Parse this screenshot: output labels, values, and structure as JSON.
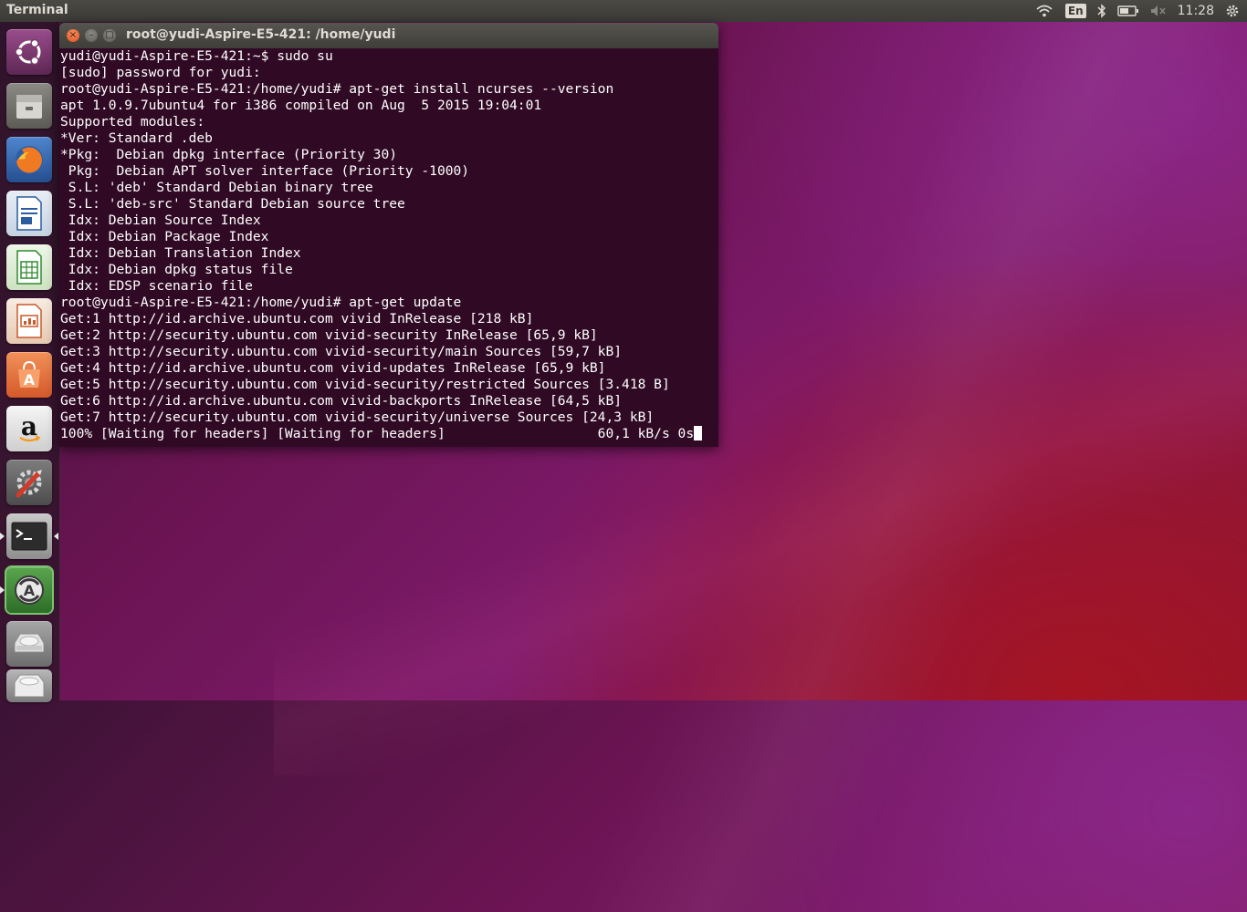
{
  "panel": {
    "app_name": "Terminal",
    "language": "En",
    "clock": "11:28",
    "icons": [
      "wifi-icon",
      "keyboard-language-icon",
      "bluetooth-icon",
      "battery-icon",
      "volume-muted-icon",
      "gear-icon"
    ]
  },
  "launcher": {
    "items": [
      {
        "name": "ubuntu-dash-icon",
        "color": "#7a3b6e"
      },
      {
        "name": "files-icon",
        "color": "#7c7a74"
      },
      {
        "name": "firefox-icon",
        "color": "#3a6fb5"
      },
      {
        "name": "libreoffice-writer-icon",
        "color": "#dde6f0"
      },
      {
        "name": "libreoffice-calc-icon",
        "color": "#e4f0dc"
      },
      {
        "name": "libreoffice-impress-icon",
        "color": "#f3e3d6"
      },
      {
        "name": "ubuntu-software-center-icon",
        "color": "#e9753a"
      },
      {
        "name": "amazon-icon",
        "color": "#e5e5e5"
      },
      {
        "name": "system-settings-icon",
        "color": "#6a6a6a"
      },
      {
        "name": "terminal-icon",
        "color": "#4a4a4a"
      },
      {
        "name": "software-updater-icon",
        "color": "#3d7a35"
      },
      {
        "name": "drive-icon",
        "color": "#8a8a8a"
      },
      {
        "name": "trash-icon",
        "color": "#9a9a9a"
      }
    ]
  },
  "window": {
    "title": "root@yudi-Aspire-E5-421: /home/yudi",
    "close_glyph": "×",
    "minimize_glyph": "–",
    "maximize_glyph": "□"
  },
  "terminal": {
    "lines": [
      "yudi@yudi-Aspire-E5-421:~$ sudo su",
      "[sudo] password for yudi:",
      "root@yudi-Aspire-E5-421:/home/yudi# apt-get install ncurses --version",
      "apt 1.0.9.7ubuntu4 for i386 compiled on Aug  5 2015 19:04:01",
      "Supported modules:",
      "*Ver: Standard .deb",
      "*Pkg:  Debian dpkg interface (Priority 30)",
      " Pkg:  Debian APT solver interface (Priority -1000)",
      " S.L: 'deb' Standard Debian binary tree",
      " S.L: 'deb-src' Standard Debian source tree",
      " Idx: Debian Source Index",
      " Idx: Debian Package Index",
      " Idx: Debian Translation Index",
      " Idx: Debian dpkg status file",
      " Idx: EDSP scenario file",
      "root@yudi-Aspire-E5-421:/home/yudi# apt-get update",
      "Get:1 http://id.archive.ubuntu.com vivid InRelease [218 kB]",
      "Get:2 http://security.ubuntu.com vivid-security InRelease [65,9 kB]",
      "Get:3 http://security.ubuntu.com vivid-security/main Sources [59,7 kB]",
      "Get:4 http://id.archive.ubuntu.com vivid-updates InRelease [65,9 kB]",
      "Get:5 http://security.ubuntu.com vivid-security/restricted Sources [3.418 B]",
      "Get:6 http://id.archive.ubuntu.com vivid-backports InRelease [64,5 kB]",
      "Get:7 http://security.ubuntu.com vivid-security/universe Sources [24,3 kB]",
      "100% [Waiting for headers] [Waiting for headers]                   60,1 kB/s 0s"
    ]
  }
}
